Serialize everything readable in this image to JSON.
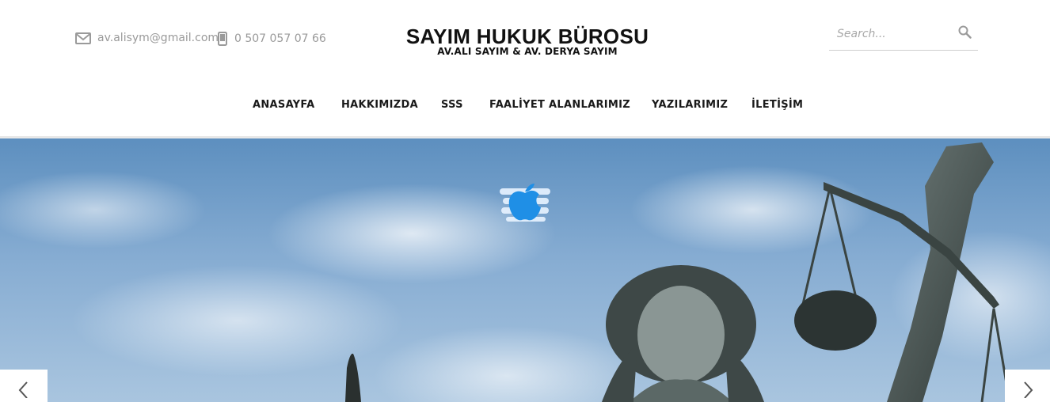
{
  "header": {
    "email": "av.alisym@gmail.com",
    "phone": "0 507 057 07 66",
    "logo_title": "SAYIM HUKUK BÜROSU",
    "logo_subtitle": "AV.ALI SAYIM & AV. DERYA SAYIM",
    "search_placeholder": "Search...",
    "icons": {
      "email": "envelope-icon",
      "phone": "mobile-phone-icon",
      "search": "search-icon"
    }
  },
  "nav": {
    "items": [
      {
        "label": "ANASAYFA"
      },
      {
        "label": "HAKKIMIZDA"
      },
      {
        "label": "SSS"
      },
      {
        "label": "FAALİYET ALANLARIMIZ"
      },
      {
        "label": "YAZILARIMIZ"
      },
      {
        "label": "İLETİŞİM"
      }
    ]
  },
  "slider": {
    "prev_icon": "chevron-left-icon",
    "next_icon": "chevron-right-icon",
    "loader_icon": "apple-icon"
  },
  "colors": {
    "accent": "#1f8fe6",
    "text": "#111111",
    "muted": "#9a9a9a"
  }
}
